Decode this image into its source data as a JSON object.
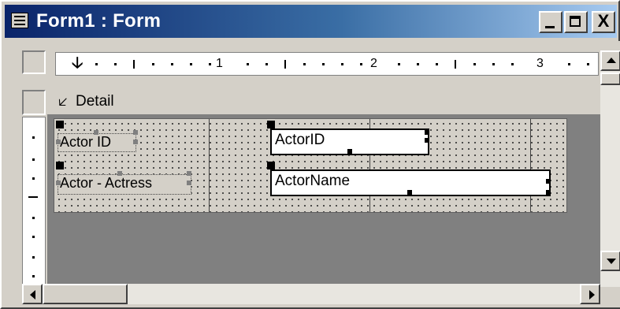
{
  "window": {
    "title": "Form1 : Form",
    "minimize_label": "_",
    "close_label": "X"
  },
  "ruler": {
    "horizontal_numbers": [
      "1",
      "2",
      "3"
    ]
  },
  "section": {
    "label": "Detail"
  },
  "controls": {
    "labels": [
      "Actor ID",
      "Actor - Actress"
    ],
    "fields": [
      "ActorID",
      "ActorName"
    ]
  },
  "colors": {
    "title_bar_start": "#0a246a",
    "title_bar_end": "#a6caf0",
    "face": "#d4d0c8",
    "workspace": "#808080"
  },
  "icons": [
    "form-icon",
    "minimize-icon",
    "maximize-icon",
    "close-icon",
    "section-arrow-icon",
    "ruler-marker-icon",
    "scroll-up-icon",
    "scroll-down-icon",
    "scroll-left-icon",
    "scroll-right-icon"
  ]
}
